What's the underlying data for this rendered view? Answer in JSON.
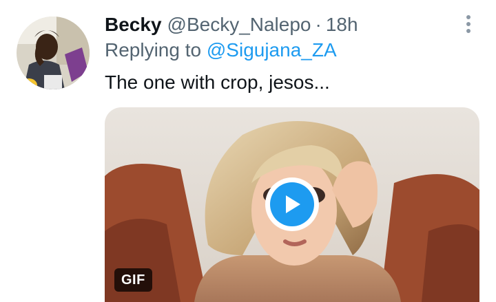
{
  "tweet": {
    "author": {
      "display_name": "Becky",
      "handle": "@Becky_Nalepo",
      "avatar_icon": "avatar-photo"
    },
    "separator": "·",
    "timestamp": "18h",
    "reply": {
      "prefix": "Replying to ",
      "mention": "@Sigujana_ZA"
    },
    "text": "The one with crop, jesos...",
    "more_icon": "more-vertical-icon",
    "media": {
      "type": "gif",
      "badge": "GIF",
      "play_icon": "play-icon"
    }
  },
  "colors": {
    "name": "#0f1419",
    "secondary": "#536471",
    "accent": "#1d9bf0"
  }
}
